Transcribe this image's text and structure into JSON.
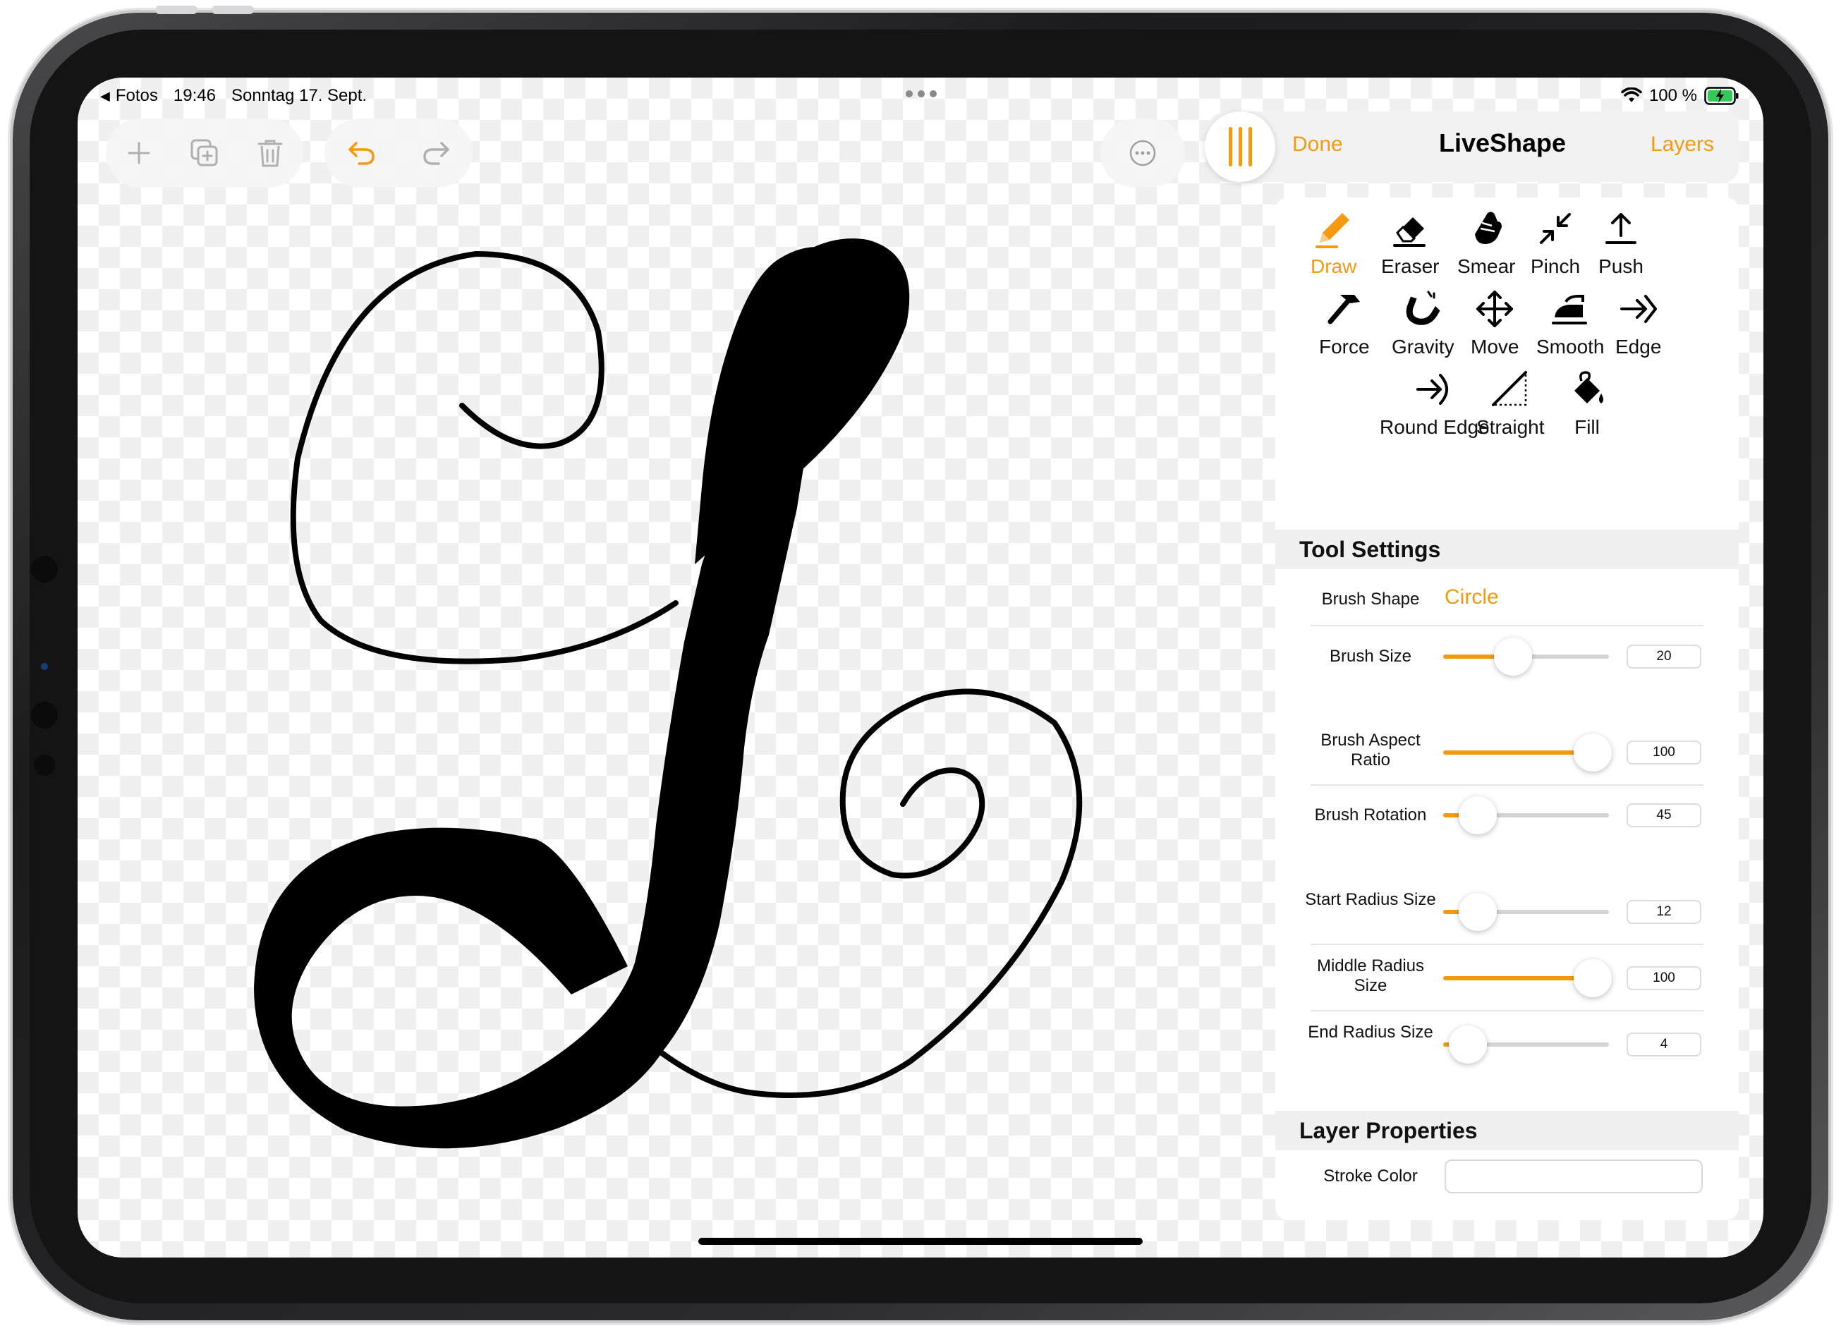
{
  "status": {
    "back_app": "Fotos",
    "time": "19:46",
    "date": "Sonntag 17. Sept.",
    "battery": "100 %"
  },
  "toolbar": {
    "add": "plus-icon",
    "duplicate": "duplicate-icon",
    "delete": "trash-icon",
    "undo": "undo-icon",
    "redo": "redo-icon",
    "more": "ellipsis-icon"
  },
  "panel": {
    "done_label": "Done",
    "title": "LiveShape",
    "layers_label": "Layers",
    "tools": [
      "Draw",
      "Eraser",
      "Smear",
      "Pinch",
      "Push",
      "Force",
      "Gravity",
      "Move",
      "Smooth",
      "Edge",
      "Round Edge",
      "Straight",
      "Fill"
    ],
    "active_tool": "Draw",
    "tool_settings_title": "Tool Settings",
    "brush_shape_label": "Brush Shape",
    "brush_shape_value": "Circle",
    "sliders": [
      {
        "label": "Brush Size",
        "value": "20",
        "fraction": 0.42
      },
      {
        "label": "Brush Aspect Ratio",
        "value": "100",
        "fraction": 0.9
      },
      {
        "label": "Brush Rotation",
        "value": "45",
        "fraction": 0.21
      },
      {
        "label": "Start Radius Size",
        "value": "12",
        "fraction": 0.21
      },
      {
        "label": "Middle Radius Size",
        "value": "100",
        "fraction": 0.9
      },
      {
        "label": "End Radius Size",
        "value": "4",
        "fraction": 0.15
      }
    ],
    "layer_properties_title": "Layer Properties",
    "stroke_color_label": "Stroke Color",
    "stroke_color_value": "#ffffff"
  },
  "colors": {
    "accent": "#f39a10",
    "stroke": "#000000"
  }
}
